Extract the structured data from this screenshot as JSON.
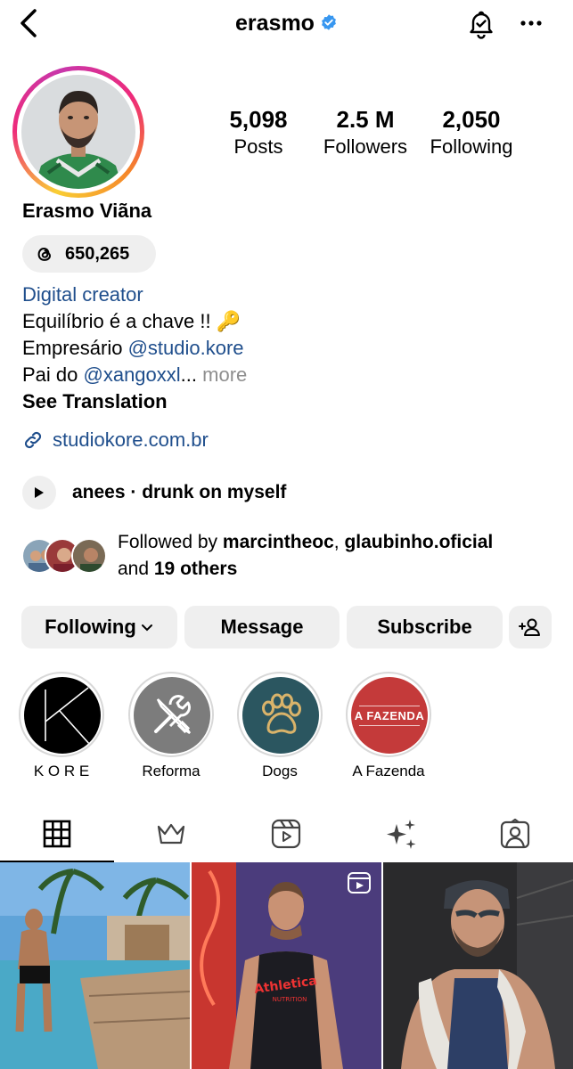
{
  "header": {
    "username": "erasmo",
    "verified": true
  },
  "profile": {
    "full_name": "Erasmo Viãna",
    "threads_count": "650,265",
    "stats": [
      {
        "value": "5,098",
        "label": "Posts"
      },
      {
        "value": "2.5 M",
        "label": "Followers"
      },
      {
        "value": "2,050",
        "label": "Following"
      }
    ]
  },
  "bio": {
    "category": "Digital creator",
    "line1": "Equilíbrio é a chave !! 🔑",
    "line2_prefix": "Empresário ",
    "line2_mention": "@studio.kore",
    "line3_prefix": "Pai do ",
    "line3_mention": "@xangoxxl",
    "line3_ellipsis": "...",
    "more": " more",
    "see_translation": "See Translation",
    "link": "studiokore.com.br"
  },
  "music": {
    "text": "anees · drunk on myself"
  },
  "followed_by": {
    "prefix": "Followed by ",
    "user1": "marcintheoc",
    "sep": ", ",
    "user2": "glaubinho.oficial",
    "and": "and ",
    "others": "19 others"
  },
  "actions": {
    "following": "Following",
    "message": "Message",
    "subscribe": "Subscribe"
  },
  "highlights": [
    {
      "label": "K O R E"
    },
    {
      "label": "Reforma"
    },
    {
      "label": "Dogs"
    },
    {
      "label": "A Fazenda",
      "cover_text": "A FAZENDA"
    }
  ],
  "colors": {
    "link_blue": "#1f4e8c",
    "button_bg": "#efefef",
    "verified_blue": "#3897f0",
    "muted": "#8e8e8e"
  },
  "tabs": [
    "grid-icon",
    "crown-icon",
    "reels-icon",
    "sparkles-icon",
    "tagged-icon"
  ]
}
